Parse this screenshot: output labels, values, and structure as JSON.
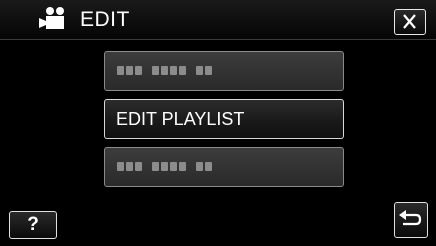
{
  "header": {
    "title": "EDIT",
    "mode_icon": "video-camera-icon",
    "close_icon": "close-icon"
  },
  "menu": {
    "items": [
      {
        "label": "",
        "state": "disabled"
      },
      {
        "label": "EDIT PLAYLIST",
        "state": "enabled"
      },
      {
        "label": "",
        "state": "disabled"
      }
    ]
  },
  "footer": {
    "help_label": "?",
    "back_icon": "return-arrow-icon"
  },
  "colors": {
    "background": "#000000",
    "button_border": "#d8d8d8",
    "disabled_fill": "#333333",
    "text": "#ffffff"
  }
}
